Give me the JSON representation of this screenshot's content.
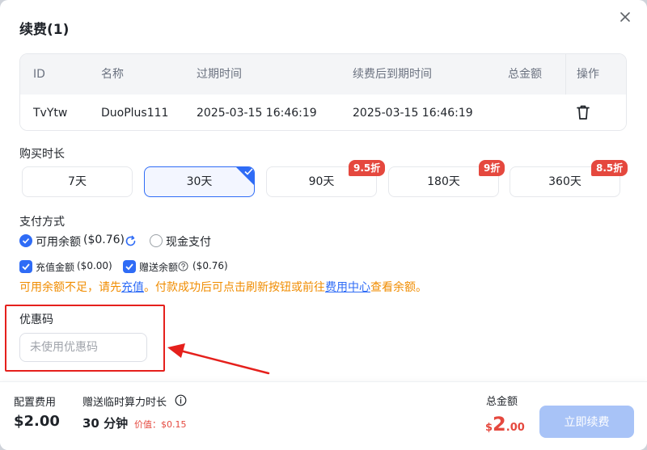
{
  "dialog": {
    "title": "续费(1)"
  },
  "table": {
    "headers": [
      "ID",
      "名称",
      "过期时间",
      "续费后到期时间",
      "总金额",
      "操作"
    ],
    "rows": [
      {
        "id": "TvYtw",
        "name": "DuoPlus111",
        "expire": "2025-03-15 16:46:19",
        "renew_expire": "2025-03-15 16:46:19",
        "total": ""
      }
    ]
  },
  "duration": {
    "label": "购买时长",
    "options": [
      {
        "label": "7天",
        "badge": ""
      },
      {
        "label": "30天",
        "badge": "",
        "selected": true
      },
      {
        "label": "90天",
        "badge": "9.5折"
      },
      {
        "label": "180天",
        "badge": "9折"
      },
      {
        "label": "360天",
        "badge": "8.5折"
      }
    ]
  },
  "payment": {
    "label": "支付方式",
    "balance_label": "可用余额",
    "balance_value": "($0.76)",
    "cash_label": "现金支付",
    "recharge_label": "充值金额",
    "recharge_value": "($0.00)",
    "gift_label": "赠送余额",
    "gift_value": "($0.76)",
    "warning_prefix": "可用余额不足，请先",
    "warning_link1": "充值",
    "warning_middle": "。付款成功后可点击刷新按钮或前往",
    "warning_link2": "费用中心",
    "warning_suffix": "查看余额。"
  },
  "promo": {
    "label": "优惠码",
    "placeholder": "未使用优惠码"
  },
  "footer": {
    "config_fee_label": "配置费用",
    "config_fee_value": "$2.00",
    "bonus_label": "赠送临时算力时长",
    "bonus_value": "30 分钟",
    "bonus_price": "价值：$0.15",
    "total_label": "总金额",
    "total_currency": "$",
    "total_int": "2",
    "total_dec": ".00",
    "submit_label": "立即续费"
  },
  "colors": {
    "accent": "#2f6cf6",
    "badge": "#e5483e",
    "warning": "#f08c00",
    "price": "#e5483e"
  }
}
